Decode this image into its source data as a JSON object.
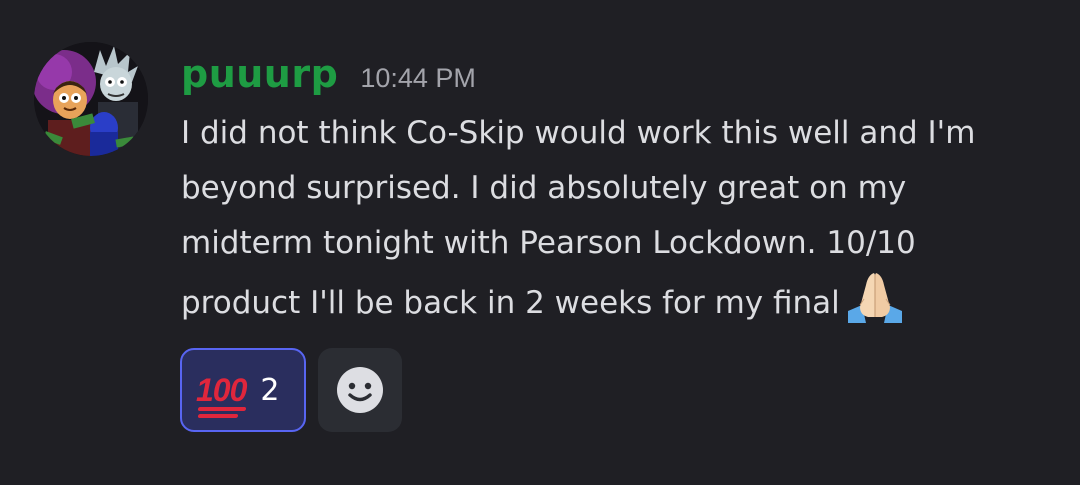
{
  "message": {
    "author": "puuurp",
    "timestamp": "10:44 PM",
    "lines": [
      "I did not think Co-Skip would work this well and I'm",
      "beyond surprised. I did absolutely great on my",
      "midterm tonight with Pearson Lockdown. 10/10",
      "product I'll be back in 2 weeks for my final"
    ],
    "trailing_emoji": "folded-hands-icon"
  },
  "reactions": [
    {
      "emoji": "100",
      "icon": "hundred-points-icon",
      "count": "2",
      "selected": true
    }
  ],
  "add_reaction_icon": "smiley-add-reaction-icon",
  "colors": {
    "background": "#1f1f24",
    "username": "#1e9c43",
    "timestamp": "#a3a4ab",
    "text": "#dcdde1",
    "reaction_selected_bg": "#2a2e5e",
    "reaction_selected_border": "#5865f2",
    "hundred_red": "#e0263c"
  }
}
